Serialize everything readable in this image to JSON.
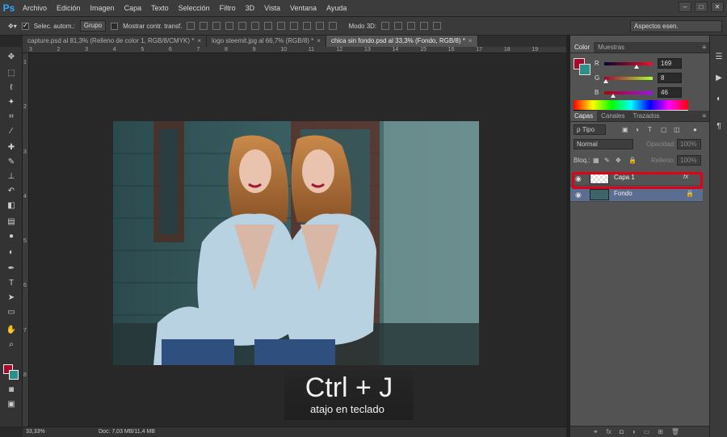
{
  "app": {
    "logo": "Ps"
  },
  "menu": [
    "Archivo",
    "Edición",
    "Imagen",
    "Capa",
    "Texto",
    "Selección",
    "Filtro",
    "3D",
    "Vista",
    "Ventana",
    "Ayuda"
  ],
  "window_controls": [
    "–",
    "□",
    "✕"
  ],
  "options_bar": {
    "auto_select_label": "Selec. autom.:",
    "auto_select_value": "Grupo",
    "transform_label": "Mostrar contr. transf.",
    "mode3d_label": "Modo 3D:",
    "workspace": "Aspectos esen."
  },
  "doc_tabs": [
    {
      "title": "capture.psd al 81,3% (Relleno de color 1, RGB/8/CMYK) *",
      "active": false
    },
    {
      "title": "logo steemit.jpg al 66,7% (RGB/8) *",
      "active": false
    },
    {
      "title": "chica sin fondo.psd al 33,3% (Fondo, RGB/8) *",
      "active": true
    }
  ],
  "tab_close": "×",
  "ruler_top_ticks": [
    "3",
    "2",
    "3",
    "4",
    "5",
    "6",
    "7",
    "8",
    "9",
    "10",
    "11",
    "12",
    "13",
    "14",
    "15",
    "16",
    "17",
    "18",
    "19"
  ],
  "ruler_left_ticks": [
    "1",
    "2",
    "3",
    "4",
    "5",
    "6",
    "7",
    "8"
  ],
  "status": {
    "zoom": "33,33%",
    "doc": "Doc: 7,03 MB/11,4 MB"
  },
  "shortcut": {
    "keys": "Ctrl + J",
    "caption": "atajo en teclado"
  },
  "color_panel": {
    "tabs": [
      "Color",
      "Muestras"
    ],
    "fg_color": "#a9082e",
    "bg_color": "#2e8f88",
    "sliders": [
      {
        "label": "R",
        "value": "169",
        "level": 0.66
      },
      {
        "label": "G",
        "value": "8",
        "level": 0.03
      },
      {
        "label": "B",
        "value": "46",
        "level": 0.18
      }
    ]
  },
  "layers_panel": {
    "tabs": [
      "Capas",
      "Canales",
      "Trazados"
    ],
    "filter": "ρ Tipo",
    "blend_mode": "Normal",
    "opacity_label": "Opacidad:",
    "opacity_value": "100%",
    "lock_label": "Bloq.:",
    "fill_label": "Relleno:",
    "fill_value": "100%",
    "layers": [
      {
        "name": "Capa 1",
        "fx": "fx",
        "selected": false
      },
      {
        "name": "Fondo",
        "lock": "🔒",
        "selected": true
      }
    ]
  },
  "accent_highlight": "#e0001a"
}
